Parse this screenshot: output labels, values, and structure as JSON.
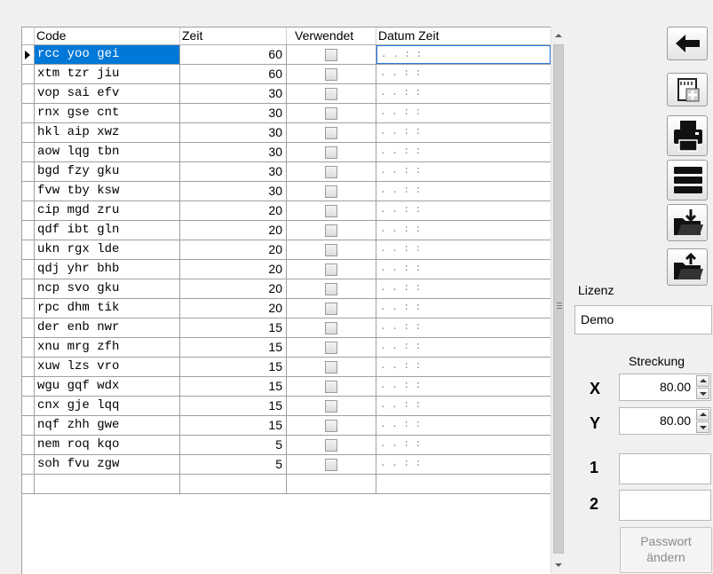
{
  "grid": {
    "headers": [
      "Code",
      "Zeit",
      "Verwendet",
      "Datum Zeit"
    ],
    "datetime_placeholder": ". .   : :",
    "rows": [
      {
        "code": "rcc yoo gei",
        "zeit": "60"
      },
      {
        "code": "xtm tzr jiu",
        "zeit": "60"
      },
      {
        "code": "vop sai efv",
        "zeit": "30"
      },
      {
        "code": "rnx gse cnt",
        "zeit": "30"
      },
      {
        "code": "hkl aip xwz",
        "zeit": "30"
      },
      {
        "code": "aow lqg tbn",
        "zeit": "30"
      },
      {
        "code": "bgd fzy gku",
        "zeit": "30"
      },
      {
        "code": "fvw tby ksw",
        "zeit": "30"
      },
      {
        "code": "cip mgd zru",
        "zeit": "20"
      },
      {
        "code": "qdf ibt gln",
        "zeit": "20"
      },
      {
        "code": "ukn rgx lde",
        "zeit": "20"
      },
      {
        "code": "qdj yhr bhb",
        "zeit": "20"
      },
      {
        "code": "ncp svo gku",
        "zeit": "20"
      },
      {
        "code": "rpc dhm tik",
        "zeit": "20"
      },
      {
        "code": "der enb nwr",
        "zeit": "15"
      },
      {
        "code": "xnu mrg zfh",
        "zeit": "15"
      },
      {
        "code": "xuw lzs vro",
        "zeit": "15"
      },
      {
        "code": "wgu gqf wdx",
        "zeit": "15"
      },
      {
        "code": "cnx gje lqq",
        "zeit": "15"
      },
      {
        "code": "nqf zhh gwe",
        "zeit": "15"
      },
      {
        "code": "nem roq kqo",
        "zeit": "5"
      },
      {
        "code": "soh fvu zgw",
        "zeit": "5"
      }
    ]
  },
  "toolbar": {
    "icons": [
      "back-arrow-icon",
      "add-document-icon",
      "print-icon",
      "menu-icon",
      "import-icon",
      "export-icon"
    ]
  },
  "license": {
    "label": "Lizenz",
    "value": "Demo"
  },
  "stretch": {
    "label": "Streckung",
    "x_label": "X",
    "x_value": "80.00",
    "y_label": "Y",
    "y_value": "80.00"
  },
  "passwords": {
    "label1": "1",
    "label2": "2",
    "value1": "",
    "value2": ""
  },
  "password_button": {
    "line1": "Passwort",
    "line2": "ändern"
  },
  "colors": {
    "selection": "#0078d7",
    "background": "#f0f0f0"
  }
}
